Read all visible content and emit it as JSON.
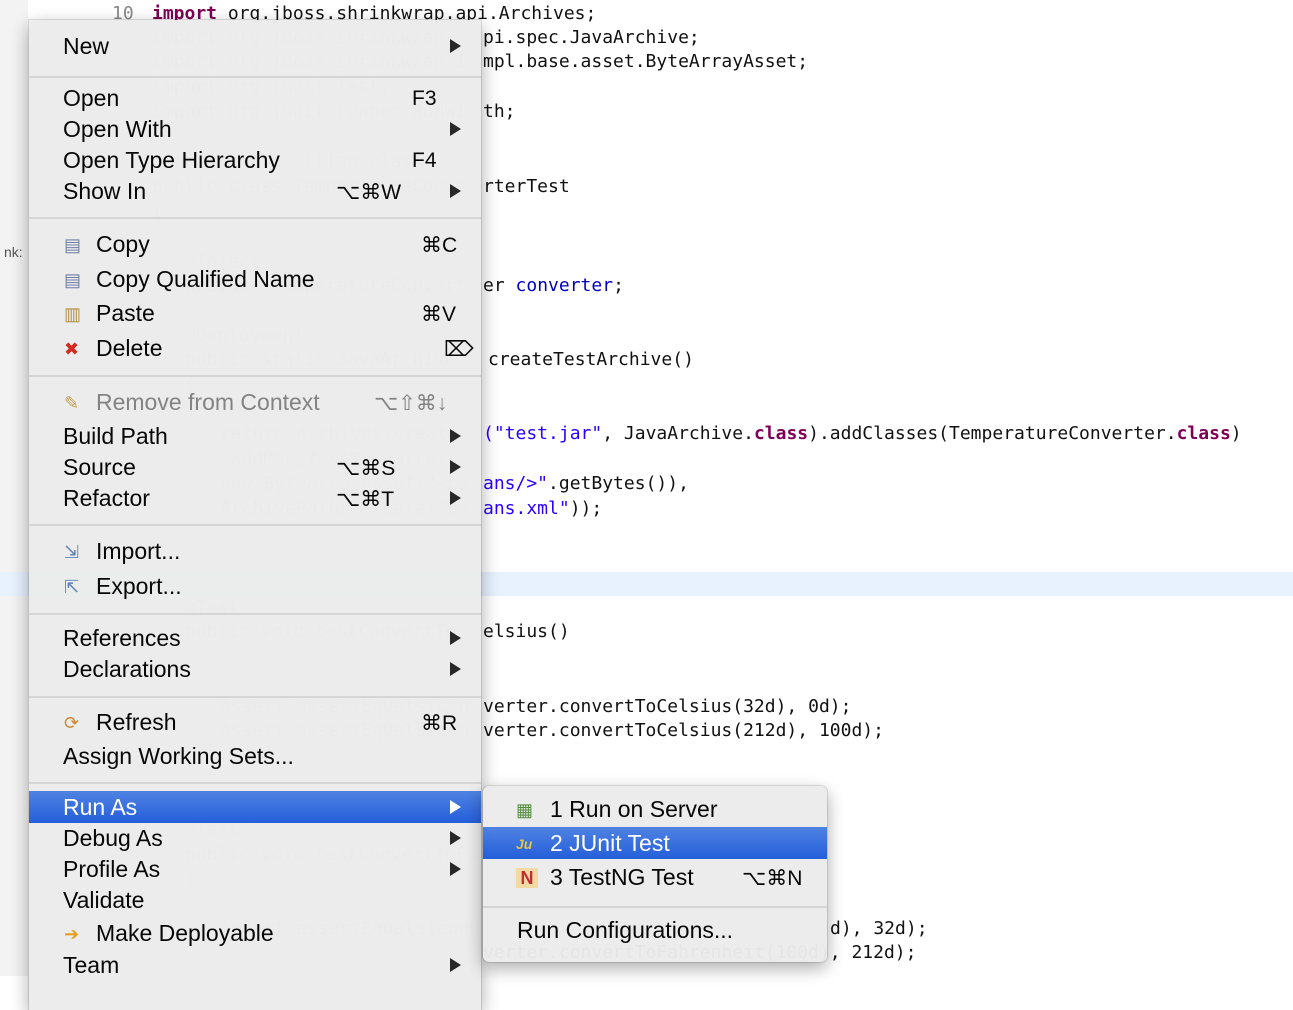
{
  "editor": {
    "line_number": "10",
    "lines": [
      {
        "parts": [
          {
            "t": "import",
            "c": "kw"
          },
          {
            "t": " org.jboss.shrinkwrap.api.Archives;",
            "c": ""
          }
        ]
      },
      {
        "parts": [
          {
            "t": "pi.spec.JavaArchive;",
            "c": ""
          }
        ]
      },
      {
        "parts": [
          {
            "t": "mpl.base.asset.ByteArrayAsset;",
            "c": ""
          }
        ]
      },
      {
        "parts": [
          {
            "t": "th;",
            "c": ""
          }
        ]
      },
      {
        "parts": [
          {
            "t": "rterTest",
            "c": ""
          }
        ]
      },
      {
        "parts": [
          {
            "t": "er ",
            "c": ""
          },
          {
            "t": "converter",
            "c": "blue"
          },
          {
            "t": ";",
            "c": ""
          }
        ]
      },
      {
        "parts": [
          {
            "t": "createTestArchive()",
            "c": ""
          }
        ]
      },
      {
        "parts": [
          {
            "t": "(\"test.jar\"",
            "c": "str"
          },
          {
            "t": ", JavaArchive.",
            "c": ""
          },
          {
            "t": "class",
            "c": "kw"
          },
          {
            "t": ").addClasses(TemperatureConverter.",
            "c": ""
          },
          {
            "t": "class",
            "c": "kw"
          },
          {
            "t": ")",
            "c": ""
          }
        ]
      },
      {
        "parts": [
          {
            "t": "ans/>\"",
            "c": "str"
          },
          {
            "t": ".getBytes()),",
            "c": ""
          }
        ]
      },
      {
        "parts": [
          {
            "t": "ans.xml\"",
            "c": "str"
          },
          {
            "t": "));",
            "c": ""
          }
        ]
      },
      {
        "parts": [
          {
            "t": "elsius()",
            "c": ""
          }
        ]
      },
      {
        "parts": [
          {
            "t": "verter.convertToCelsius(32d), 0d);",
            "c": ""
          }
        ]
      },
      {
        "parts": [
          {
            "t": "verter.convertToCelsius(212d), 100d);",
            "c": ""
          }
        ]
      },
      {
        "parts": [
          {
            "t": "d), 32d);",
            "c": ""
          }
        ]
      },
      {
        "parts": [
          {
            "t": "verter.convertToFahrenheit(100d), 212d);",
            "c": ""
          }
        ]
      }
    ],
    "side_fragment": "nk:"
  },
  "context_menu": {
    "items": [
      {
        "name": "menu-item-new",
        "label": "New",
        "submenu": true
      },
      {
        "name": "menu-item-open",
        "label": "Open",
        "shortcut": "F3"
      },
      {
        "name": "menu-item-open-with",
        "label": "Open With",
        "submenu": true
      },
      {
        "name": "menu-item-open-type-hierarchy",
        "label": "Open Type Hierarchy",
        "shortcut": "F4"
      },
      {
        "name": "menu-item-show-in",
        "label": "Show In",
        "shortcut": "⌥⌘W",
        "submenu": true
      },
      {
        "name": "menu-item-copy",
        "label": "Copy",
        "shortcut": "⌘C",
        "icon": "copy-icon"
      },
      {
        "name": "menu-item-copy-qualified-name",
        "label": "Copy Qualified Name",
        "icon": "copy-qualified-name-icon"
      },
      {
        "name": "menu-item-paste",
        "label": "Paste",
        "shortcut": "⌘V",
        "icon": "paste-icon"
      },
      {
        "name": "menu-item-delete",
        "label": "Delete",
        "shortcut": "⌦",
        "icon": "delete-icon"
      },
      {
        "name": "menu-item-remove-from-context",
        "label": "Remove from Context",
        "shortcut": "⌥⇧⌘↓",
        "icon": "remove-context-icon",
        "disabled": true
      },
      {
        "name": "menu-item-build-path",
        "label": "Build Path",
        "submenu": true
      },
      {
        "name": "menu-item-source",
        "label": "Source",
        "shortcut": "⌥⌘S",
        "submenu": true
      },
      {
        "name": "menu-item-refactor",
        "label": "Refactor",
        "shortcut": "⌥⌘T",
        "submenu": true
      },
      {
        "name": "menu-item-import",
        "label": "Import...",
        "icon": "import-icon"
      },
      {
        "name": "menu-item-export",
        "label": "Export...",
        "icon": "export-icon"
      },
      {
        "name": "menu-item-references",
        "label": "References",
        "submenu": true
      },
      {
        "name": "menu-item-declarations",
        "label": "Declarations",
        "submenu": true
      },
      {
        "name": "menu-item-refresh",
        "label": "Refresh",
        "shortcut": "⌘R",
        "icon": "refresh-icon"
      },
      {
        "name": "menu-item-assign-working-sets",
        "label": "Assign Working Sets..."
      },
      {
        "name": "menu-item-run-as",
        "label": "Run As",
        "submenu": true,
        "selected": true
      },
      {
        "name": "menu-item-debug-as",
        "label": "Debug As",
        "submenu": true
      },
      {
        "name": "menu-item-profile-as",
        "label": "Profile As",
        "submenu": true
      },
      {
        "name": "menu-item-validate",
        "label": "Validate"
      },
      {
        "name": "menu-item-make-deployable",
        "label": "Make Deployable",
        "icon": "make-deployable-icon"
      },
      {
        "name": "menu-item-team",
        "label": "Team",
        "submenu": true
      }
    ]
  },
  "run_as_submenu": {
    "items": [
      {
        "name": "submenu-item-run-on-server",
        "label": "1 Run on Server",
        "icon": "server-icon"
      },
      {
        "name": "submenu-item-junit-test",
        "label": "2 JUnit Test",
        "icon": "junit-icon",
        "selected": true
      },
      {
        "name": "submenu-item-testng-test",
        "label": "3 TestNG Test",
        "shortcut": "⌥⌘N",
        "icon": "testng-icon"
      },
      {
        "name": "submenu-item-run-configurations",
        "label": "Run Configurations..."
      }
    ]
  },
  "colors": {
    "selection": "#1e5ad9",
    "menu_bg": "#ececec",
    "keyword": "#7f0055",
    "string": "#2a00ff",
    "field": "#0000c0"
  }
}
